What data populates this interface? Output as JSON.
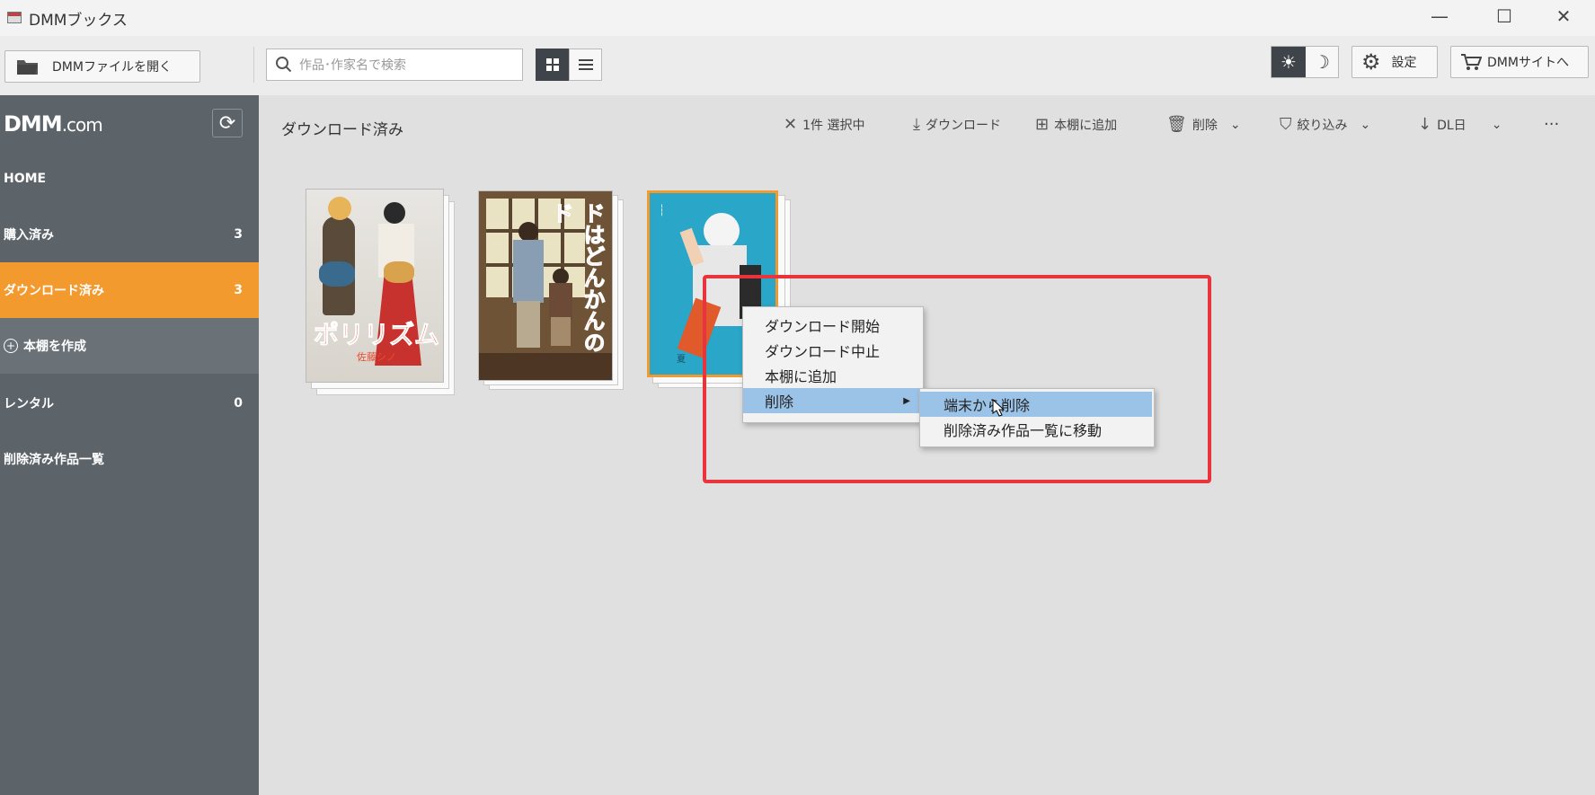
{
  "window": {
    "title": "DMMブックス",
    "minimize": "—",
    "maximize": "☐",
    "close": "✕"
  },
  "toolbar": {
    "open_file": "DMMファイルを開く",
    "search_placeholder": "作品･作家名で検索",
    "settings": "設定",
    "site": "DMMサイトへ"
  },
  "sidebar": {
    "logo_main": "DMM",
    "logo_suffix": ".com",
    "items": [
      {
        "label": "HOME",
        "count": ""
      },
      {
        "label": "購入済み",
        "count": "3"
      },
      {
        "label": "ダウンロード済み",
        "count": "3"
      },
      {
        "label": "本棚を作成",
        "count": ""
      },
      {
        "label": "レンタル",
        "count": "0"
      },
      {
        "label": "削除済み作品一覧",
        "count": ""
      }
    ]
  },
  "main": {
    "title": "ダウンロード済み",
    "actions": {
      "selected": "1件 選択中",
      "download": "ダウンロード",
      "add_shelf": "本棚に追加",
      "delete": "削除",
      "filter": "絞り込み",
      "sort": "DL日",
      "more": "···"
    }
  },
  "books": [
    {
      "title_text": "ポリリズム",
      "author": "佐藤シノ"
    },
    {
      "title_text": "ドはどんかんのド"
    },
    {
      "title_text": "夏"
    }
  ],
  "context_menu": {
    "items": [
      "ダウンロード開始",
      "ダウンロード中止",
      "本棚に追加",
      "削除"
    ],
    "submenu": [
      "端末から削除",
      "削除済み作品一覧に移動"
    ]
  },
  "colors": {
    "accent": "#f39a2e",
    "sidebar": "#5d6469",
    "highlight_box": "#e8353d",
    "menu_hover": "#9bc3e8"
  }
}
